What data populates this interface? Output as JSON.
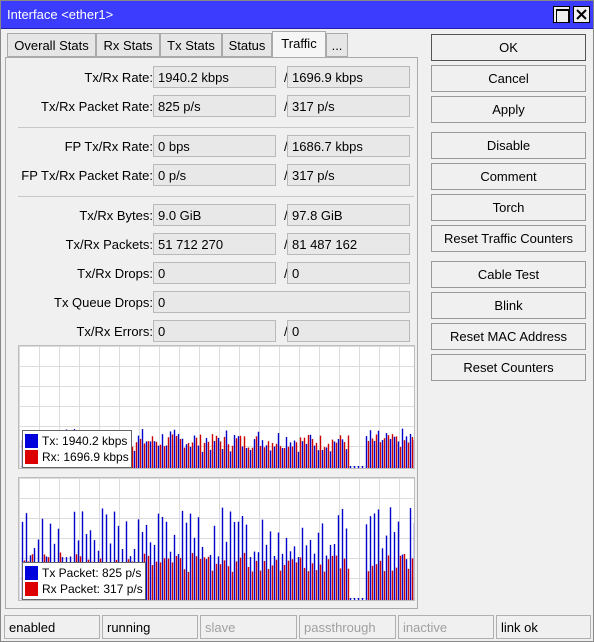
{
  "window": {
    "title": "Interface <ether1>"
  },
  "tabs": [
    {
      "label": "Overall Stats"
    },
    {
      "label": "Rx Stats"
    },
    {
      "label": "Tx Stats"
    },
    {
      "label": "Status"
    },
    {
      "label": "Traffic"
    },
    {
      "label": "..."
    }
  ],
  "active_tab": "Traffic",
  "fields": {
    "txrx_rate": {
      "label": "Tx/Rx Rate:",
      "tx": "1940.2 kbps",
      "rx": "1696.9 kbps"
    },
    "txrx_packet_rate": {
      "label": "Tx/Rx Packet Rate:",
      "tx": "825 p/s",
      "rx": "317 p/s"
    },
    "fp_txrx_rate": {
      "label": "FP Tx/Rx Rate:",
      "tx": "0 bps",
      "rx": "1686.7 kbps"
    },
    "fp_txrx_packet_rate": {
      "label": "FP Tx/Rx Packet Rate:",
      "tx": "0 p/s",
      "rx": "317 p/s"
    },
    "txrx_bytes": {
      "label": "Tx/Rx Bytes:",
      "tx": "9.0 GiB",
      "rx": "97.8 GiB"
    },
    "txrx_packets": {
      "label": "Tx/Rx Packets:",
      "tx": "51 712 270",
      "rx": "81 487 162"
    },
    "txrx_drops": {
      "label": "Tx/Rx Drops:",
      "tx": "0",
      "rx": "0"
    },
    "tx_queue_drops": {
      "label": "Tx Queue Drops:",
      "value": "0"
    },
    "txrx_errors": {
      "label": "Tx/Rx Errors:",
      "tx": "0",
      "rx": "0"
    },
    "slash": "/"
  },
  "graphs": {
    "traffic": {
      "legend": [
        {
          "label": "Tx:",
          "value": "1940.2 kbps",
          "color": "#0000dd"
        },
        {
          "label": "Rx:",
          "value": "1696.9 kbps",
          "color": "#dd0000"
        }
      ]
    },
    "packets": {
      "legend": [
        {
          "label": "Tx Packet:",
          "value": "825 p/s",
          "color": "#0000dd"
        },
        {
          "label": "Rx Packet:",
          "value": "317 p/s",
          "color": "#dd0000"
        }
      ]
    }
  },
  "buttons": {
    "ok": "OK",
    "cancel": "Cancel",
    "apply": "Apply",
    "disable": "Disable",
    "comment": "Comment",
    "torch": "Torch",
    "reset_traffic_counters": "Reset Traffic Counters",
    "cable_test": "Cable Test",
    "blink": "Blink",
    "reset_mac_address": "Reset MAC Address",
    "reset_counters": "Reset Counters"
  },
  "status_bar": {
    "enabled": "enabled",
    "running": "running",
    "slave": "slave",
    "passthrough": "passthrough",
    "inactive": "inactive",
    "link": "link ok"
  }
}
